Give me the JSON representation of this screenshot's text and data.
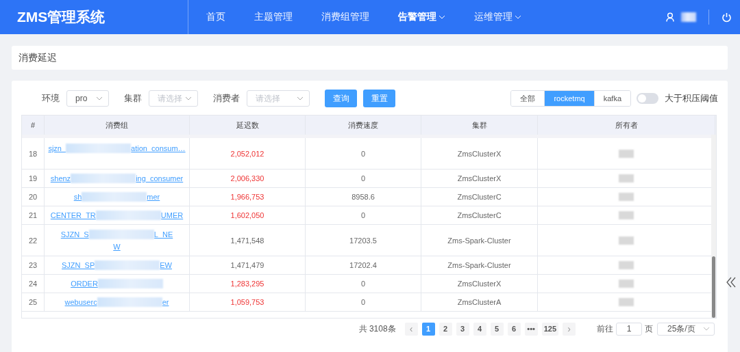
{
  "app": {
    "title": "ZMS管理系统"
  },
  "nav": [
    {
      "label": "首页",
      "selected": false,
      "dropdown": false
    },
    {
      "label": "主题管理",
      "selected": false,
      "dropdown": false
    },
    {
      "label": "消费组管理",
      "selected": false,
      "dropdown": false
    },
    {
      "label": "告警管理",
      "selected": true,
      "dropdown": true
    },
    {
      "label": "运维管理",
      "selected": false,
      "dropdown": true
    }
  ],
  "breadcrumb": "消费延迟",
  "filters": [
    {
      "label": "环境",
      "value": "pro"
    },
    {
      "label": "集群",
      "placeholder": "请选择"
    },
    {
      "label": "消费者",
      "placeholder": "请选择"
    }
  ],
  "buttons": [
    "查询",
    "重置"
  ],
  "segments": [
    {
      "label": "全部",
      "selected": false
    },
    {
      "label": "rocketmq",
      "selected": true
    },
    {
      "label": "kafka",
      "selected": false
    }
  ],
  "threshold_switch": {
    "label": "大于积压阈值",
    "on": false
  },
  "table": {
    "columns": [
      "#",
      "消费组",
      "延迟数",
      "消费速度",
      "集群",
      "所有者"
    ],
    "rows": [
      {
        "index": "18",
        "group": [
          "sjzn_",
          "ation_consum…"
        ],
        "lag": "2,052,012",
        "alert": true,
        "speed": "0",
        "cluster": "ZmsClusterX",
        "tall": true
      },
      {
        "index": "19",
        "group": [
          "shenz",
          "ing_consumer"
        ],
        "lag": "2,006,330",
        "alert": true,
        "speed": "0",
        "cluster": "ZmsClusterX",
        "tall": false
      },
      {
        "index": "20",
        "group": [
          "sh",
          "mer"
        ],
        "lag": "1,966,753",
        "alert": true,
        "speed": "8958.6",
        "cluster": "ZmsClusterC",
        "tall": false
      },
      {
        "index": "21",
        "group": [
          "CENTER_TR",
          "UMER"
        ],
        "lag": "1,602,050",
        "alert": true,
        "speed": "0",
        "cluster": "ZmsClusterC",
        "tall": false
      },
      {
        "index": "22",
        "group": [
          "SJZN_S",
          "L_NE"
        ],
        "group_line2": "W",
        "lag": "1,471,548",
        "alert": false,
        "speed": "17203.5",
        "cluster": "Zms-Spark-Cluster",
        "tall": true
      },
      {
        "index": "23",
        "group": [
          "SJZN_SP",
          "EW"
        ],
        "lag": "1,471,479",
        "alert": false,
        "speed": "17202.4",
        "cluster": "Zms-Spark-Cluster",
        "tall": false
      },
      {
        "index": "24",
        "group": [
          "ORDER"
        ],
        "lag": "1,283,295",
        "alert": true,
        "speed": "0",
        "cluster": "ZmsClusterX",
        "tall": false
      },
      {
        "index": "25",
        "group": [
          "webuserc",
          "er"
        ],
        "lag": "1,059,753",
        "alert": true,
        "speed": "0",
        "cluster": "ZmsClusterA",
        "tall": false
      }
    ]
  },
  "pagination": {
    "total": "共 3108条",
    "prev": "‹",
    "pages": [
      {
        "label": "1",
        "selected": true
      },
      {
        "label": "2",
        "selected": false
      },
      {
        "label": "3",
        "selected": false
      },
      {
        "label": "4",
        "selected": false
      },
      {
        "label": "5",
        "selected": false
      },
      {
        "label": "6",
        "selected": false
      },
      {
        "label": "•••",
        "selected": false
      },
      {
        "label": "125",
        "selected": false
      }
    ],
    "next": "›",
    "goto_label": "前往",
    "goto_value": "1",
    "page_unit": "页",
    "page_size": "25条/页"
  }
}
